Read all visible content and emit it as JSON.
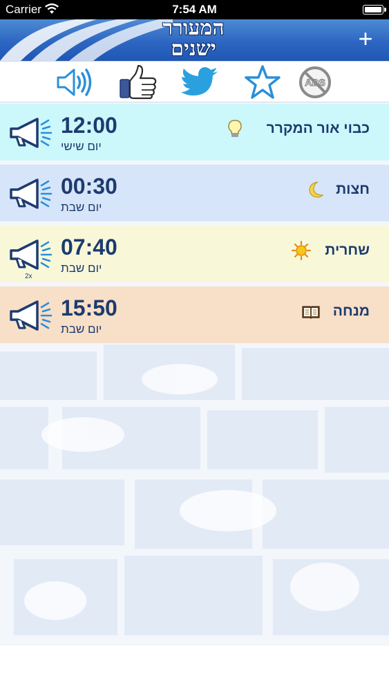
{
  "status_bar": {
    "carrier": "Carrier",
    "time": "7:54 AM"
  },
  "header": {
    "title_line1": "המעורר",
    "title_line2": "ישנים",
    "add_label": "+"
  },
  "toolbar": {
    "icons": [
      "speaker-icon",
      "thumbs-up-icon",
      "twitter-bird-icon",
      "star-icon",
      "no-ads-icon"
    ],
    "no_ads_label": "ADS"
  },
  "alarms": [
    {
      "name": "כבוי אור המקרר",
      "time": "12:00",
      "day": "יום שישי",
      "icon": "light-bulb-icon",
      "color": "#ccf7fb",
      "badge": ""
    },
    {
      "name": "חצות",
      "time": "00:30",
      "day": "יום שבת",
      "icon": "moon-icon",
      "color": "#d6e5f9",
      "badge": ""
    },
    {
      "name": "שחרית",
      "time": "07:40",
      "day": "יום שבת",
      "icon": "sun-icon",
      "color": "#f8f8d9",
      "badge": "2x"
    },
    {
      "name": "מנחה",
      "time": "15:50",
      "day": "יום שבת",
      "icon": "book-icon",
      "color": "#f8dfc7",
      "badge": ""
    }
  ],
  "colors": {
    "header_blue": "#2d66c2",
    "text_navy": "#1d3b6e",
    "icon_blue": "#2a8fd9",
    "wall_blue": "#e7eef8"
  }
}
